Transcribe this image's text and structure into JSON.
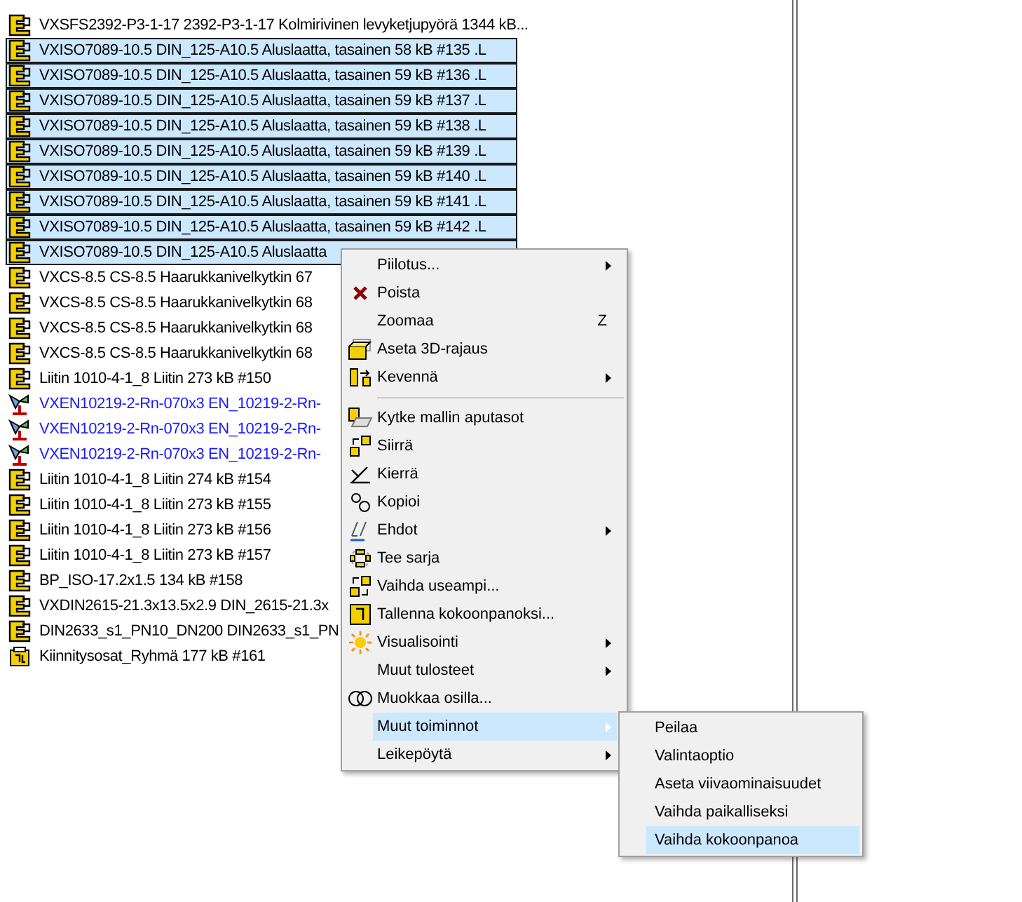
{
  "tree": [
    {
      "kind": "part",
      "text": "VXSFS2392-P3-1-17 2392-P3-1-17 Kolmirivinen levyketjupyörä 1344 kB...",
      "selected": false
    },
    {
      "kind": "part",
      "text": "VXISO7089-10.5 DIN_125-A10.5 Aluslaatta, tasainen 58 kB #135 .L",
      "selected": true
    },
    {
      "kind": "part",
      "text": "VXISO7089-10.5 DIN_125-A10.5 Aluslaatta, tasainen 59 kB #136 .L",
      "selected": true
    },
    {
      "kind": "part",
      "text": "VXISO7089-10.5 DIN_125-A10.5 Aluslaatta, tasainen 59 kB #137 .L",
      "selected": true
    },
    {
      "kind": "part",
      "text": "VXISO7089-10.5 DIN_125-A10.5 Aluslaatta, tasainen 59 kB #138 .L",
      "selected": true
    },
    {
      "kind": "part",
      "text": "VXISO7089-10.5 DIN_125-A10.5 Aluslaatta, tasainen 59 kB #139 .L",
      "selected": true
    },
    {
      "kind": "part",
      "text": "VXISO7089-10.5 DIN_125-A10.5 Aluslaatta, tasainen 59 kB #140 .L",
      "selected": true
    },
    {
      "kind": "part",
      "text": "VXISO7089-10.5 DIN_125-A10.5 Aluslaatta, tasainen 59 kB #141 .L",
      "selected": true
    },
    {
      "kind": "part",
      "text": "VXISO7089-10.5 DIN_125-A10.5 Aluslaatta, tasainen 59 kB #142 .L",
      "selected": true
    },
    {
      "kind": "part",
      "text": "VXISO7089-10.5 DIN_125-A10.5 Aluslaatta",
      "selected": true
    },
    {
      "kind": "part",
      "text": "VXCS-8.5 CS-8.5 Haarukkanivelkytkin 67",
      "selected": false
    },
    {
      "kind": "part",
      "text": "VXCS-8.5 CS-8.5 Haarukkanivelkytkin 68",
      "selected": false
    },
    {
      "kind": "part",
      "text": "VXCS-8.5 CS-8.5 Haarukkanivelkytkin 68",
      "selected": false
    },
    {
      "kind": "part",
      "text": "VXCS-8.5 CS-8.5 Haarukkanivelkytkin 68",
      "selected": false
    },
    {
      "kind": "part",
      "text": "Liitin 1010-4-1_8 Liitin 273 kB #150",
      "selected": false
    },
    {
      "kind": "weld",
      "text": "VXEN10219-2-Rn-070x3 EN_10219-2-Rn-",
      "selected": false
    },
    {
      "kind": "weld",
      "text": "VXEN10219-2-Rn-070x3 EN_10219-2-Rn-",
      "selected": false
    },
    {
      "kind": "weld",
      "text": "VXEN10219-2-Rn-070x3 EN_10219-2-Rn-",
      "selected": false
    },
    {
      "kind": "part",
      "text": "Liitin 1010-4-1_8 Liitin 274 kB #154",
      "selected": false
    },
    {
      "kind": "part",
      "text": "Liitin 1010-4-1_8 Liitin 273 kB #155",
      "selected": false
    },
    {
      "kind": "part",
      "text": "Liitin 1010-4-1_8 Liitin 273 kB #156",
      "selected": false
    },
    {
      "kind": "part",
      "text": "Liitin 1010-4-1_8 Liitin 273 kB #157",
      "selected": false
    },
    {
      "kind": "part",
      "text": "BP_ISO-17.2x1.5 134 kB #158",
      "selected": false
    },
    {
      "kind": "part",
      "text": "VXDIN2615-21.3x13.5x2.9 DIN_2615-21.3x",
      "selected": false
    },
    {
      "kind": "part",
      "text": "DIN2633_s1_PN10_DN200 DIN2633_s1_PN",
      "selected": false
    },
    {
      "kind": "group",
      "text": "Kiinnitysosat_Ryhmä 177 kB #161",
      "selected": false
    }
  ],
  "context_menu": [
    {
      "kind": "plain",
      "label": "Piilotus...",
      "submenu": true,
      "selected": false
    },
    {
      "kind": "delete",
      "label": "Poista",
      "submenu": false,
      "selected": false
    },
    {
      "kind": "plain",
      "label": "Zoomaa",
      "shortcut": "Z",
      "submenu": false,
      "selected": false
    },
    {
      "kind": "box",
      "label": "Aseta 3D-rajaus",
      "submenu": false,
      "selected": false
    },
    {
      "kind": "simplify",
      "label": "Kevennä",
      "submenu": true,
      "selected": false
    },
    {
      "kind": "separator"
    },
    {
      "kind": "planes",
      "label": "Kytke mallin aputasot",
      "submenu": false,
      "selected": false
    },
    {
      "kind": "move",
      "label": "Siirrä",
      "submenu": false,
      "selected": false
    },
    {
      "kind": "rotate",
      "label": "Kierrä",
      "submenu": false,
      "selected": false
    },
    {
      "kind": "copy",
      "label": "Kopioi",
      "submenu": false,
      "selected": false
    },
    {
      "kind": "constraint",
      "label": "Ehdot",
      "submenu": true,
      "selected": false
    },
    {
      "kind": "pattern",
      "label": "Tee sarja",
      "submenu": false,
      "selected": false
    },
    {
      "kind": "replace",
      "label": "Vaihda useampi...",
      "submenu": false,
      "selected": false
    },
    {
      "kind": "save",
      "label": "Tallenna kokoonpanoksi...",
      "submenu": false,
      "selected": false
    },
    {
      "kind": "sun",
      "label": "Visualisointi",
      "submenu": true,
      "selected": false
    },
    {
      "kind": "plain",
      "label": "Muut tulosteet",
      "submenu": true,
      "selected": false
    },
    {
      "kind": "rings",
      "label": "Muokkaa osilla...",
      "submenu": false,
      "selected": false
    },
    {
      "kind": "plain",
      "label": "Muut toiminnot",
      "submenu": true,
      "selected": true
    },
    {
      "kind": "plain",
      "label": "Leikepöytä",
      "submenu": true,
      "selected": false
    }
  ],
  "submenu": [
    {
      "label": "Peilaa",
      "selected": false
    },
    {
      "label": "Valintaoptio",
      "selected": false
    },
    {
      "label": "Aseta viivaominaisuudet",
      "selected": false
    },
    {
      "label": "Vaihda paikalliseksi",
      "selected": false
    },
    {
      "label": "Vaihda kokoonpanoa",
      "selected": true
    }
  ]
}
